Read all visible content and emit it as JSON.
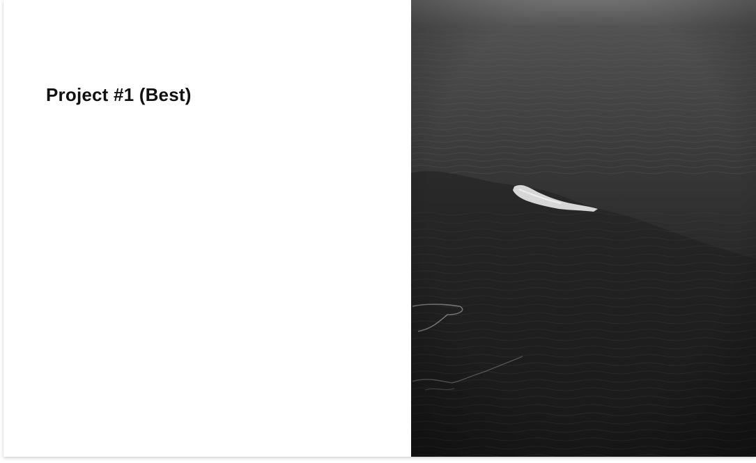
{
  "project_card": {
    "title": "Project #1 (Best)",
    "image": {
      "icon": "ocean-wave-photo",
      "colors": {
        "sky": "#6f6f6f",
        "far_water": "#4a4a4a",
        "mid_water": "#2f2f2f",
        "deep_water": "#1c1c1c",
        "foam": "#e8e8e8"
      }
    }
  }
}
